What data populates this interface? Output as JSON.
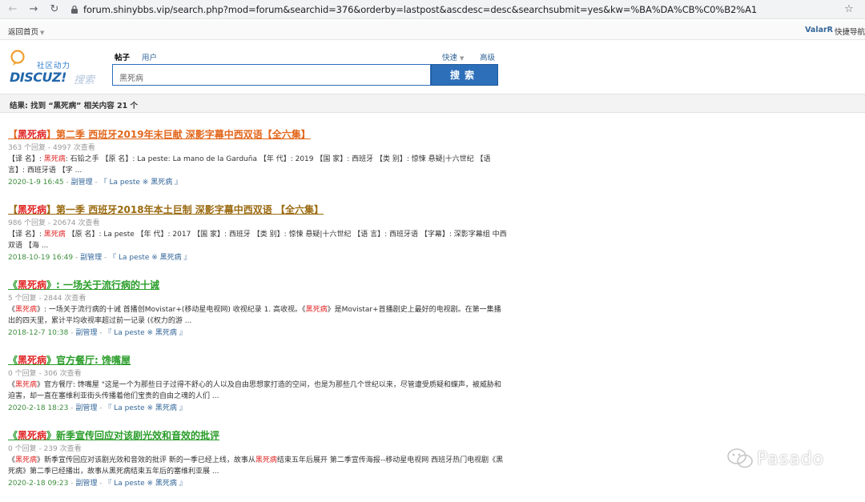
{
  "browser": {
    "url": "forum.shinybbs.vip/search.php?mod=forum&searchid=376&orderby=lastpost&ascdesc=desc&searchsubmit=yes&kw=%BA%DA%CB%C0%B2%A1"
  },
  "topbar": {
    "home": "返回首页",
    "username": "ValarR",
    "quicknav": "快捷导航"
  },
  "header": {
    "logo_slogan": "社区动力",
    "logo_brand": "DISCUZ!",
    "logo_sub": "搜索",
    "tab_posts": "帖子",
    "tab_users": "用户",
    "quick": "快速",
    "advanced": "高级",
    "search_value": "黑死病",
    "search_button": "搜索"
  },
  "result_summary": "结果: 找到 “黑死病” 相关内容 21 个",
  "results": [
    {
      "title_pre": "【",
      "title_hl": "黑死病",
      "title_post": "】第二季 西班牙2019年末巨献 深影字幕中西双语【全六集】",
      "title_color": "#e2671c",
      "meta": "363 个回复 - 4997 次查看",
      "snip_a": "【译 名】: ",
      "snip_hl1": "黑死病",
      "snip_b": ": 石铅之手 【原 名】: La peste: La mano de la Garduña 【年 代】: 2019 【国 家】: 西班牙 【类 别】: 惊悚 悬疑|十六世纪 【语 言】: 西班牙语 【字 ...",
      "snip_hl2": "",
      "snip_c": "",
      "date": "2020-1-9 16:45",
      "cat": "副管理",
      "forum": "『 La peste ※ 黑死病 』"
    },
    {
      "title_pre": "【",
      "title_hl": "黑死病",
      "title_post": "】第一季 西班牙2018年本土巨制 深影字幕中西双语 【全六集】",
      "title_color": "#9a6a10",
      "meta": "986 个回复 - 20674 次查看",
      "snip_a": "【译 名】: ",
      "snip_hl1": "黑死病",
      "snip_b": " 【原 名】: La peste 【年 代】: 2017 【国 家】: 西班牙 【类 别】: 惊悚 悬疑|十六世纪 【语 言】: 西班牙语 【字幕】: 深影字幕组 中西双语 【海 ...",
      "snip_hl2": "",
      "snip_c": "",
      "date": "2018-10-19 16:49",
      "cat": "副管理",
      "forum": "『 La peste ※ 黑死病 』"
    },
    {
      "title_pre": "《",
      "title_hl": "黑死病",
      "title_post": "》: 一场关于流行病的十诫",
      "title_color": "#2a9d2a",
      "meta": "5 个回复 - 2844 次查看",
      "snip_a": "《",
      "snip_hl1": "黑死病",
      "snip_b": "》: 一场关于流行病的十诫 首播创Movistar+(移动星电视网) 收视纪录 1. 高收视。《",
      "snip_hl2": "黑死病",
      "snip_c": "》是Movistar+首播剧史上最好的电视剧。在第一集播出的四天里，累计平均收视率超过前一记录 (《权力的游 ...",
      "date": "2018-12-7 10:38",
      "cat": "副管理",
      "forum": "『 La peste ※ 黑死病 』"
    },
    {
      "title_pre": "《",
      "title_hl": "黑死病",
      "title_post": "》官方餐厅: 馋嘴屋",
      "title_color": "#2a9d2a",
      "meta": "0 个回复 - 306 次查看",
      "snip_a": "《",
      "snip_hl1": "黑死病",
      "snip_b": "》官方餐厅: 馋嘴屋 \"这是一个为那些日子过得不舒心的人以及自由思想家打造的空间，也是为那些几个世纪以来，尽管遭受质疑和蝶声，被威胁和迫害，却一直在塞维利亚街头传播着他们宝贵的自由之魂的人们 ...",
      "snip_hl2": "",
      "snip_c": "",
      "date": "2020-2-18 18:23",
      "cat": "副管理",
      "forum": "『 La peste ※ 黑死病 』"
    },
    {
      "title_pre": "《",
      "title_hl": "黑死病",
      "title_post": "》新季宣传回应对该剧光效和音效的批评",
      "title_color": "#2a9d2a",
      "meta": "0 个回复 - 239 次查看",
      "snip_a": "《",
      "snip_hl1": "黑死病",
      "snip_b": "》新季宣传回应对该剧光效和音效的批评 新的一季已经上线，故事从",
      "snip_hl2": "黑死病",
      "snip_c": "结束五年后展开 第二季宣传海报--移动星电视网 西班牙热门电视剧《黑死病》第二季已经播出，故事从黑死病结束五年后的塞维利亚展 ...",
      "date": "2020-2-18 09:23",
      "cat": "副管理",
      "forum": "『 La peste ※ 黑死病 』"
    }
  ],
  "watermark": "Pasado"
}
